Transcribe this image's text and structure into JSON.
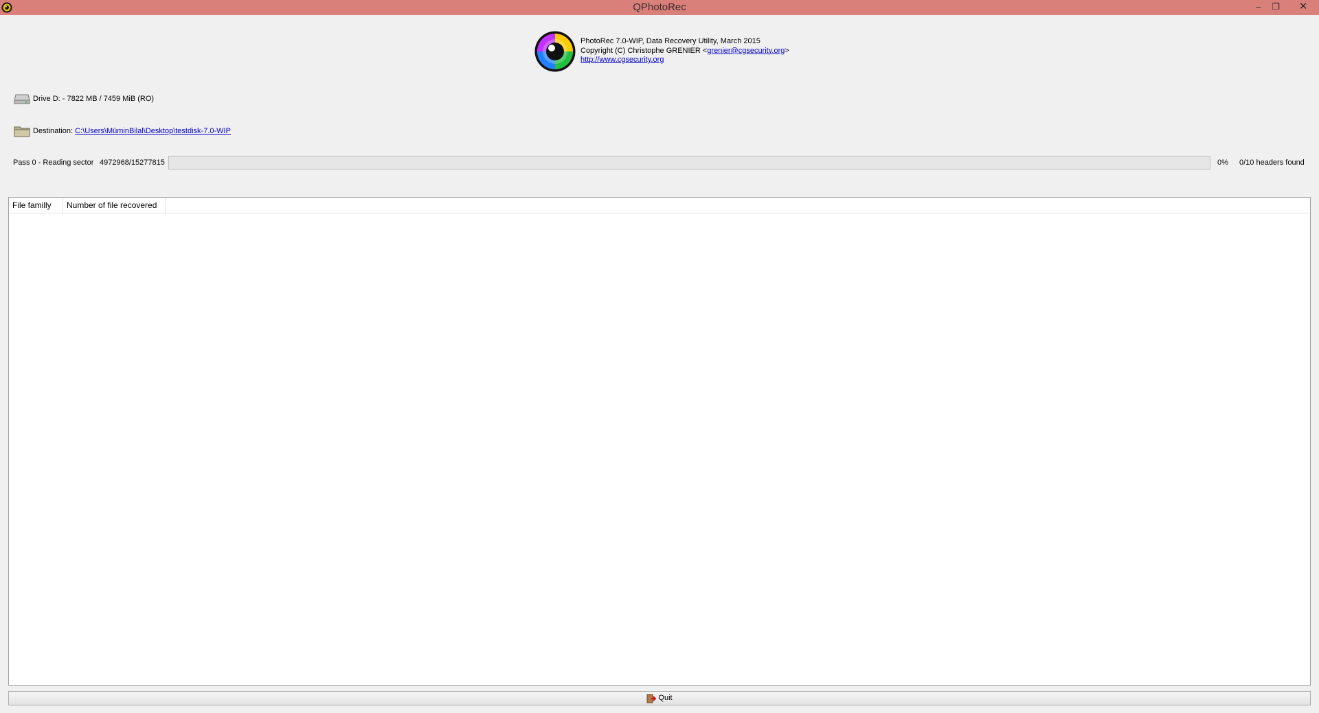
{
  "window": {
    "title": "QPhotoRec",
    "controls": {
      "minimize": "–",
      "maximize": "❐",
      "close": "✕"
    }
  },
  "header": {
    "line1": "PhotoRec 7.0-WIP, Data Recovery Utility, March 2015",
    "line2_prefix": "Copyright (C) Christophe GRENIER <",
    "email": "grenier@cgsecurity.org",
    "line2_suffix": ">",
    "website": "http://www.cgsecurity.org"
  },
  "drive": {
    "icon": "hard-drive-icon",
    "label": "Drive D: - 7822 MB / 7459 MiB (RO)"
  },
  "destination": {
    "icon": "folder-icon",
    "label": "Destination:",
    "path": "C:\\Users\\MüminBilal\\Desktop\\testdisk-7.0-WIP"
  },
  "progress": {
    "pass_label": "Pass 0 - Reading sector",
    "sector": "4972968/15277815",
    "percent": "0%",
    "percent_value": 0,
    "headers_found": "0/10 headers found"
  },
  "table": {
    "columns": [
      "File familly",
      "Number of file recovered"
    ],
    "rows": []
  },
  "quit_button": {
    "label": "Quit",
    "icon": "exit-door-icon"
  },
  "colors": {
    "titlebar": "#d9807a",
    "link": "#0000cc",
    "background": "#f0f0f0"
  }
}
